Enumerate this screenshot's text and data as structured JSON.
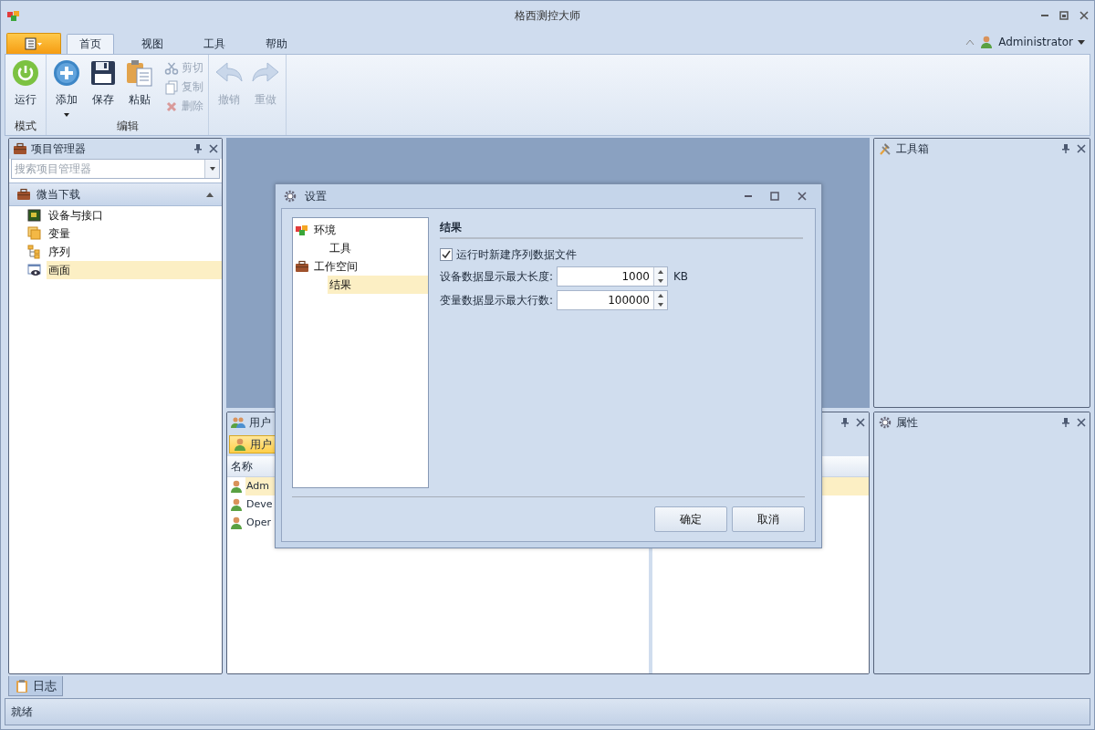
{
  "window": {
    "title": "格西测控大师",
    "user": "Administrator"
  },
  "ribbon": {
    "tabs": [
      {
        "label": "首页",
        "selected": true
      },
      {
        "label": "视图",
        "selected": false
      },
      {
        "label": "工具",
        "selected": false
      },
      {
        "label": "帮助",
        "selected": false
      }
    ],
    "groups": [
      {
        "label": "模式",
        "buttons": [
          {
            "label": "运行",
            "kind": "large",
            "disabled": false
          }
        ]
      },
      {
        "label": "编辑",
        "buttons": [
          {
            "label": "添加",
            "kind": "large",
            "disabled": false,
            "dropdown": true
          },
          {
            "label": "保存",
            "kind": "large",
            "disabled": false
          },
          {
            "label": "粘贴",
            "kind": "large",
            "disabled": false
          },
          {
            "label": "剪切",
            "kind": "small",
            "disabled": true
          },
          {
            "label": "复制",
            "kind": "small",
            "disabled": true
          },
          {
            "label": "删除",
            "kind": "small",
            "disabled": true
          }
        ]
      },
      {
        "buttons": [
          {
            "label": "撤销",
            "kind": "large",
            "disabled": true
          },
          {
            "label": "重做",
            "kind": "large",
            "disabled": true
          }
        ]
      }
    ]
  },
  "project_panel": {
    "title": "项目管理器",
    "search": {
      "placeholder": "搜索项目管理器"
    },
    "group": {
      "label": "微当下载",
      "expanded": true
    },
    "items": [
      {
        "label": "设备与接口",
        "selected": false
      },
      {
        "label": "变量",
        "selected": false
      },
      {
        "label": "序列",
        "selected": false
      },
      {
        "label": "画面",
        "selected": true
      }
    ]
  },
  "toolbox_panel": {
    "title": "工具箱"
  },
  "properties_panel": {
    "title": "属性"
  },
  "users_panel": {
    "title": "用户",
    "toolbar_button": "用户",
    "column": "名称",
    "rows": [
      {
        "name": "Adm",
        "selected": true
      },
      {
        "name": "Deve",
        "selected": false
      },
      {
        "name": "Oper",
        "selected": false
      }
    ]
  },
  "bottom_tabs": [
    {
      "label": "日志",
      "selected": true
    }
  ],
  "status_bar": "就绪",
  "dialog": {
    "title": "设置",
    "tree": [
      {
        "label": "环境",
        "selected": false,
        "children": [
          {
            "label": "工具",
            "selected": false
          }
        ]
      },
      {
        "label": "工作空间",
        "selected": false,
        "children": [
          {
            "label": "结果",
            "selected": true
          }
        ]
      }
    ],
    "section_title": "结果",
    "checkbox": {
      "label": "运行时新建序列数据文件",
      "checked": true
    },
    "fields": [
      {
        "label": "设备数据显示最大长度:",
        "value": "1000",
        "unit": "KB"
      },
      {
        "label": "变量数据显示最大行数:",
        "value": "100000"
      }
    ],
    "buttons": [
      "确定",
      "取消"
    ]
  }
}
